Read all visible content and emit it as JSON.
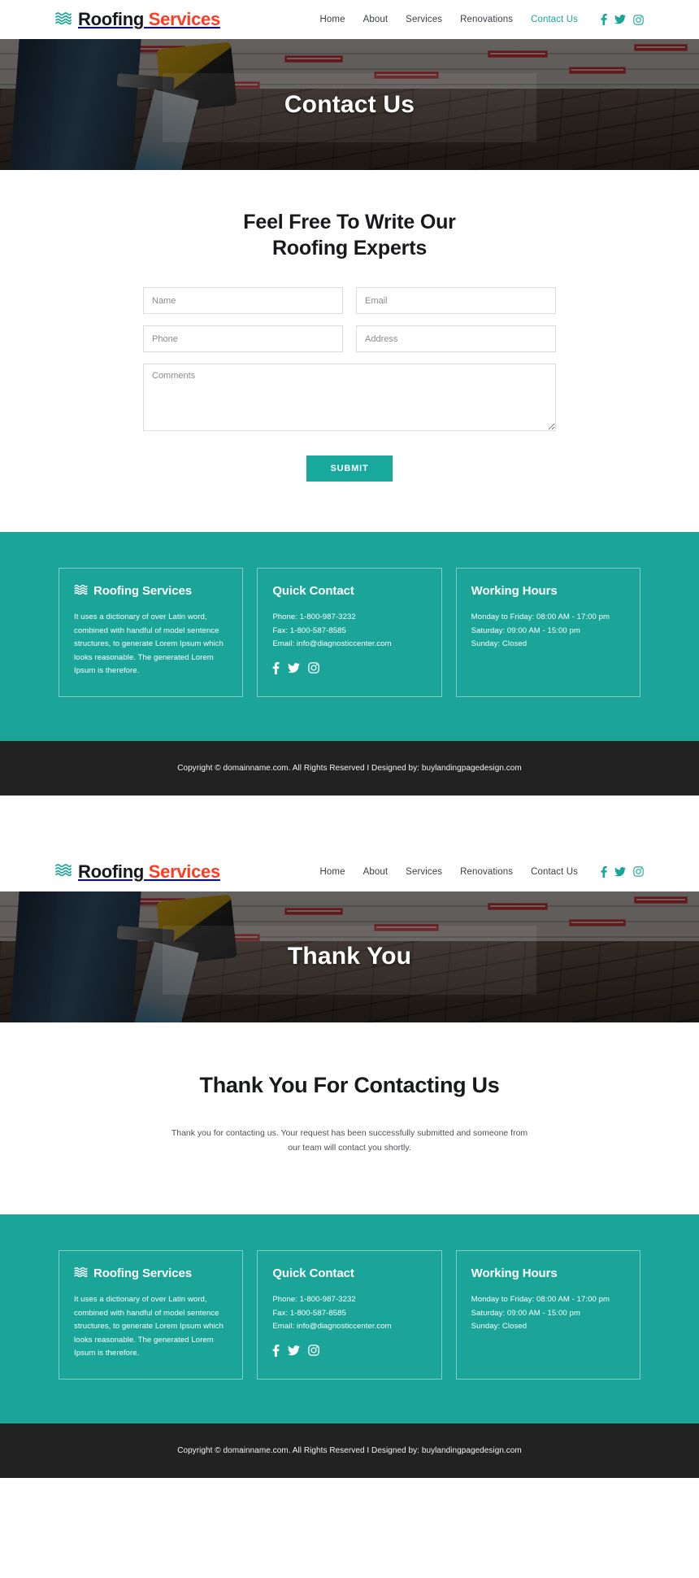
{
  "brand": {
    "icon": "waves-icon",
    "part1": "Roofing",
    "part2": "Services"
  },
  "colors": {
    "teal": "#1ba598",
    "teal_button": "#18a99c",
    "brand_red": "#ff3b21",
    "dark_bar": "#222222",
    "heading": "#17191c"
  },
  "header": {
    "nav": [
      {
        "label": "Home",
        "active": false
      },
      {
        "label": "About",
        "active": false
      },
      {
        "label": "Services",
        "active": false
      },
      {
        "label": "Renovations",
        "active": false
      },
      {
        "label": "Contact Us",
        "active": true
      }
    ],
    "social": [
      {
        "name": "facebook-icon",
        "label": "f"
      },
      {
        "name": "twitter-icon",
        "label": "t"
      },
      {
        "name": "instagram-icon",
        "label": "i"
      }
    ]
  },
  "header2": {
    "nav": [
      {
        "label": "Home",
        "active": false
      },
      {
        "label": "About",
        "active": false
      },
      {
        "label": "Services",
        "active": false
      },
      {
        "label": "Renovations",
        "active": false
      },
      {
        "label": "Contact Us",
        "active": false
      }
    ]
  },
  "hero": {
    "title": "Contact Us"
  },
  "hero2": {
    "title": "Thank You"
  },
  "form": {
    "heading_line1": "Feel Free To Write Our",
    "heading_line2": "Roofing Experts",
    "fields": {
      "name": {
        "placeholder": "Name",
        "value": ""
      },
      "email": {
        "placeholder": "Email",
        "value": ""
      },
      "phone": {
        "placeholder": "Phone",
        "value": ""
      },
      "address": {
        "placeholder": "Address",
        "value": ""
      },
      "comments": {
        "placeholder": "Comments",
        "value": ""
      }
    },
    "submit_label": "SUBMIT"
  },
  "thank_you": {
    "title": "Thank You For Contacting Us",
    "message": "Thank you for contacting us. Your request has been successfully submitted and someone from our team will contact you shortly."
  },
  "footer": {
    "about": {
      "title": "Roofing Services",
      "text": "It uses a dictionary of over Latin word, combined with handful of model sentence structures, to generate Lorem Ipsum which looks reasonable. The generated Lorem Ipsum is therefore."
    },
    "quick_contact": {
      "title": "Quick Contact",
      "phone": "Phone: 1-800-987-3232",
      "fax": "Fax: 1-800-587-8585",
      "email": "Email: info@diagnosticcenter.com"
    },
    "working_hours": {
      "title": "Working Hours",
      "weekdays": "Monday to Friday: 08:00 AM - 17:00 pm",
      "saturday": "Saturday: 09:00 AM - 15:00 pm",
      "sunday": "Sunday: Closed"
    },
    "copyright": "Copyright © domainname.com. All Rights Reserved I Designed by: buylandingpagedesign.com"
  }
}
